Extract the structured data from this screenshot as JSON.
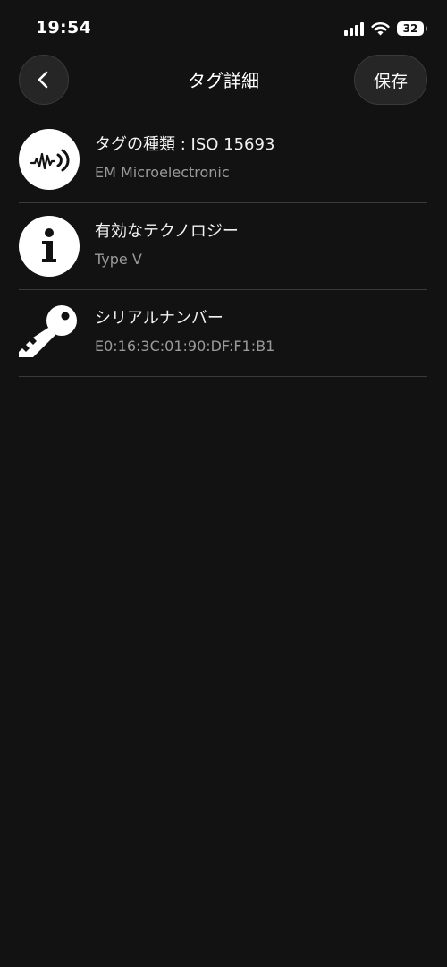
{
  "status_bar": {
    "time": "19:54",
    "battery_level": "32",
    "icons": [
      "signal-icon",
      "wifi-icon",
      "battery-icon"
    ]
  },
  "nav": {
    "title": "タグ詳細",
    "back_icon": "chevron-left-icon",
    "save_label": "保存"
  },
  "details": [
    {
      "icon": "nfc-signal-icon",
      "title": "タグの種類 : ISO 15693",
      "subtitle": "EM Microelectronic"
    },
    {
      "icon": "info-icon",
      "title": "有効なテクノロジー",
      "subtitle": "Type V"
    },
    {
      "icon": "key-icon",
      "title": "シリアルナンバー",
      "subtitle": "E0:16:3C:01:90:DF:F1:B1"
    }
  ],
  "colors": {
    "background": "#121212",
    "divider": "#3a3a3a",
    "button_bg": "#262626",
    "primary_text": "#ffffff",
    "secondary_text": "#9a9a9a"
  }
}
